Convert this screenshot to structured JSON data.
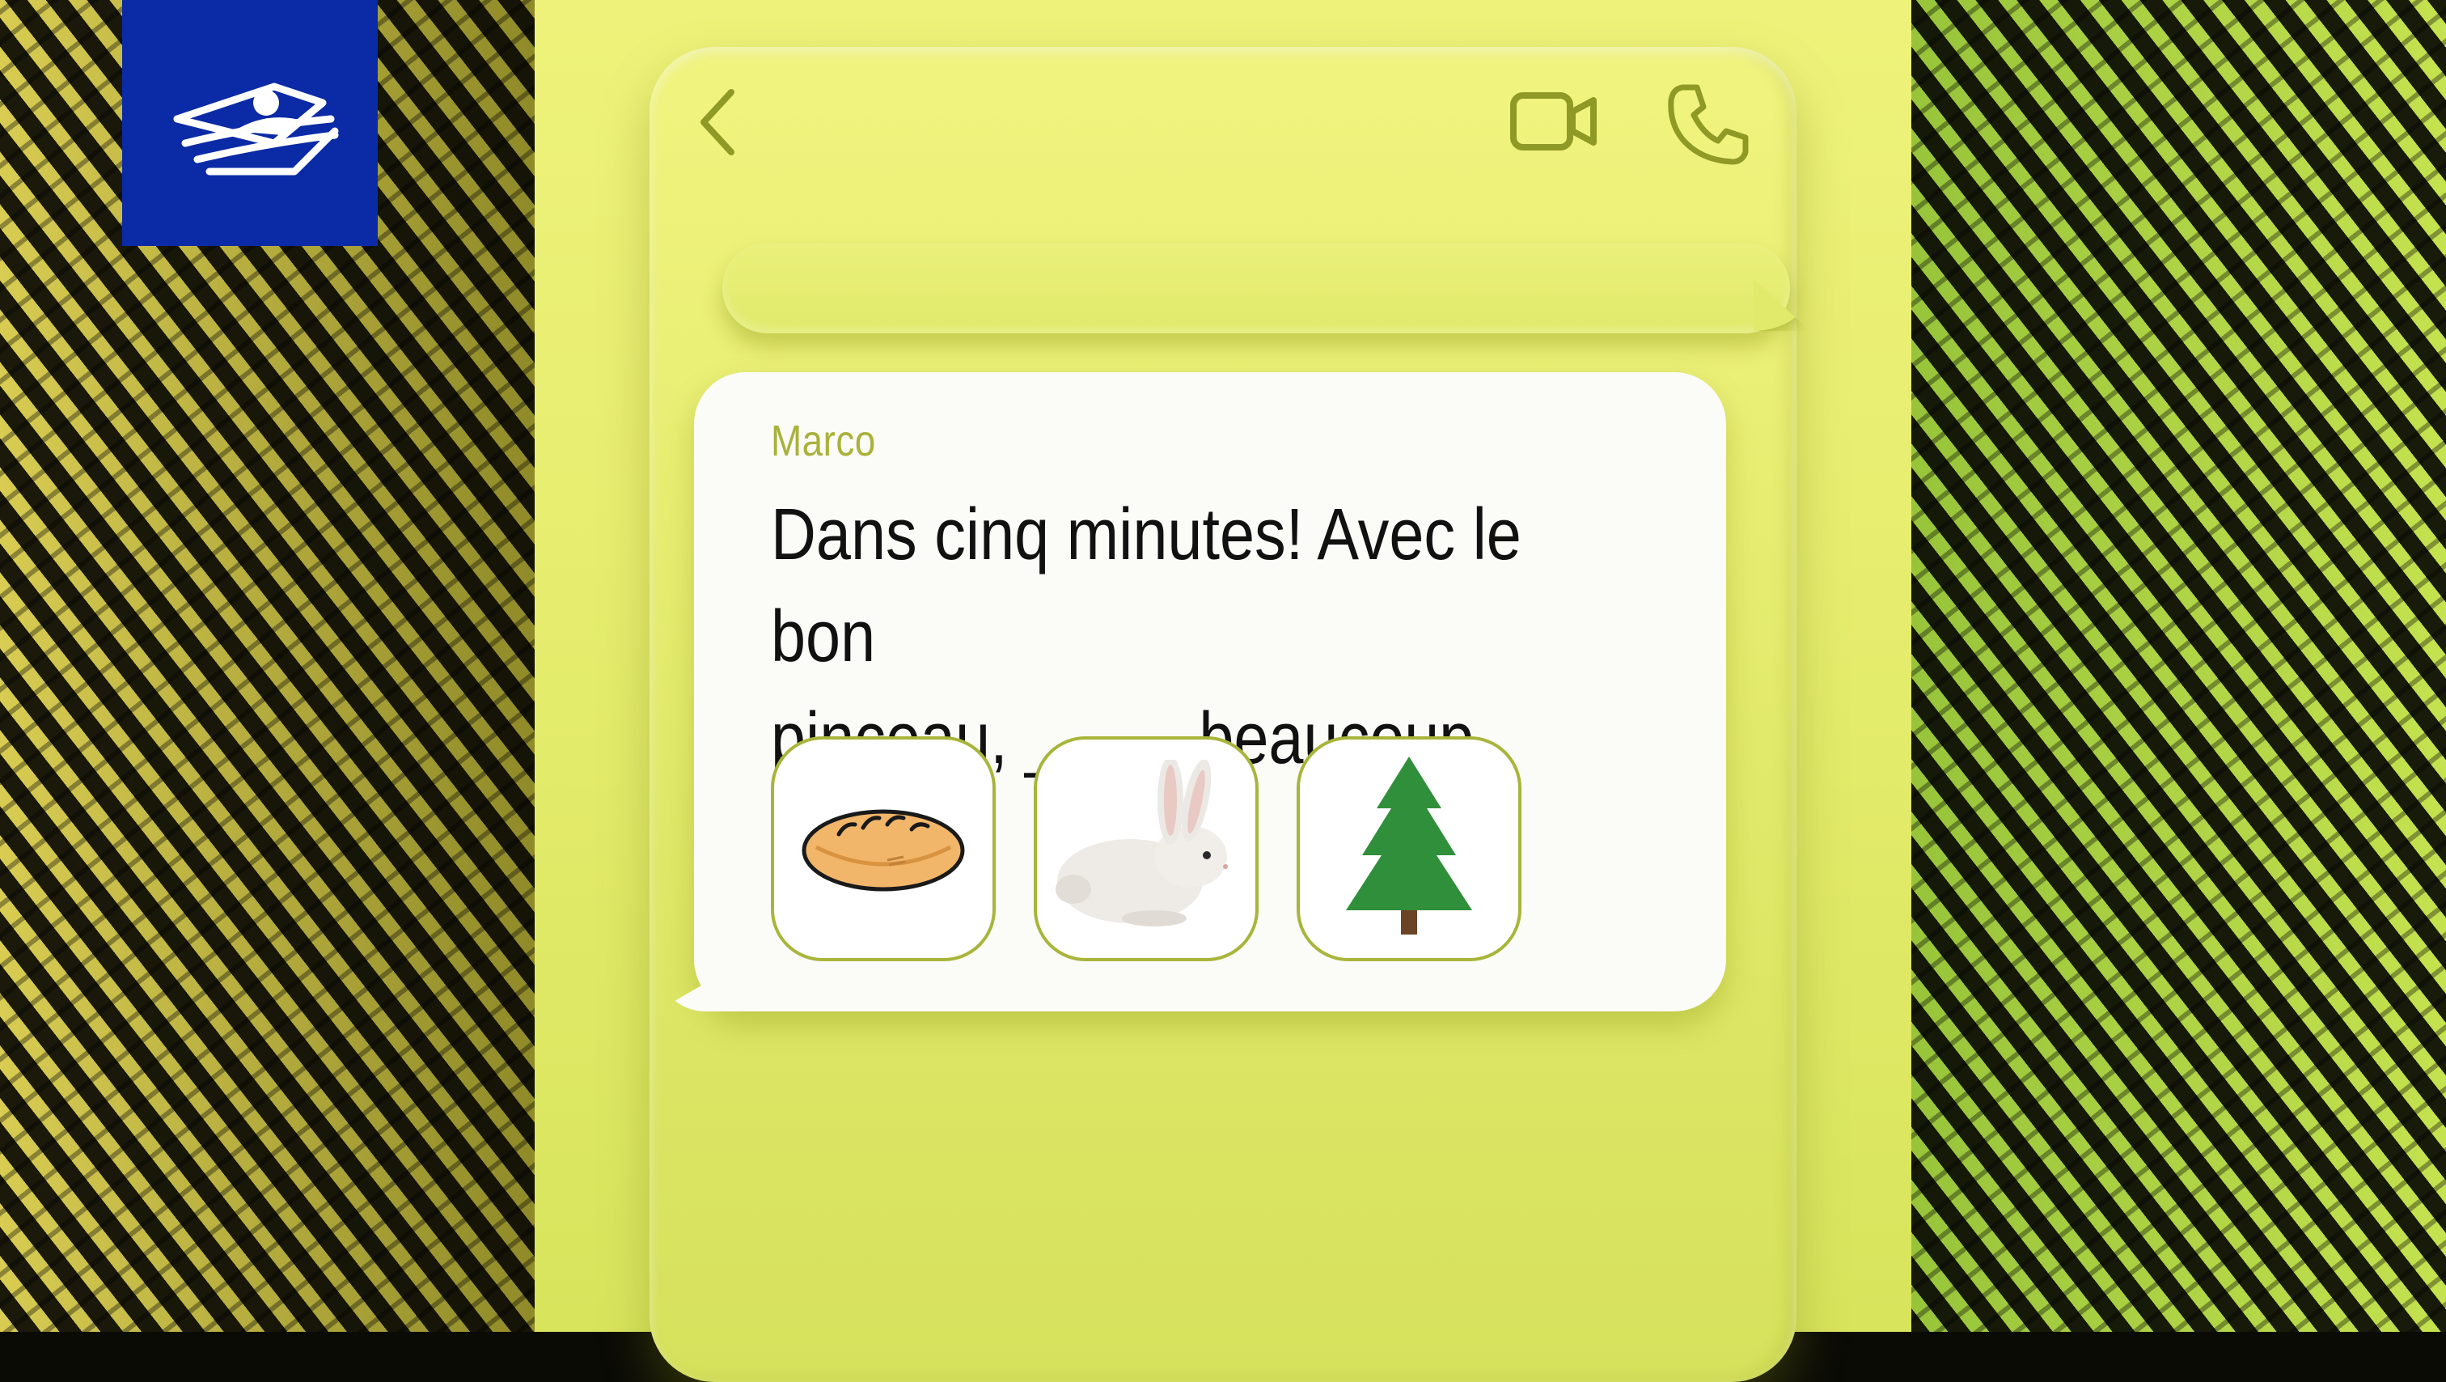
{
  "header": {
    "back_icon": "chevron-left-icon",
    "video_icon": "video-camera-icon",
    "call_icon": "phone-icon"
  },
  "logo": {
    "icon": "tv5-photo-stack-logo"
  },
  "chat": {
    "incoming": {
      "sender": "Marco",
      "text": "Dans cinq minutes! Avec le bon\npinceau, __ __ beaucoup mieux!"
    },
    "choices": [
      {
        "icon": "bread-icon"
      },
      {
        "icon": "rabbit-icon"
      },
      {
        "icon": "pine-tree-icon"
      }
    ]
  },
  "colors": {
    "panel": "#e6ed6e",
    "logo_bg": "#0b2aa6",
    "sender": "#a9b23a",
    "choice_border": "#a8b53a",
    "tree": "#2f8f3a"
  }
}
